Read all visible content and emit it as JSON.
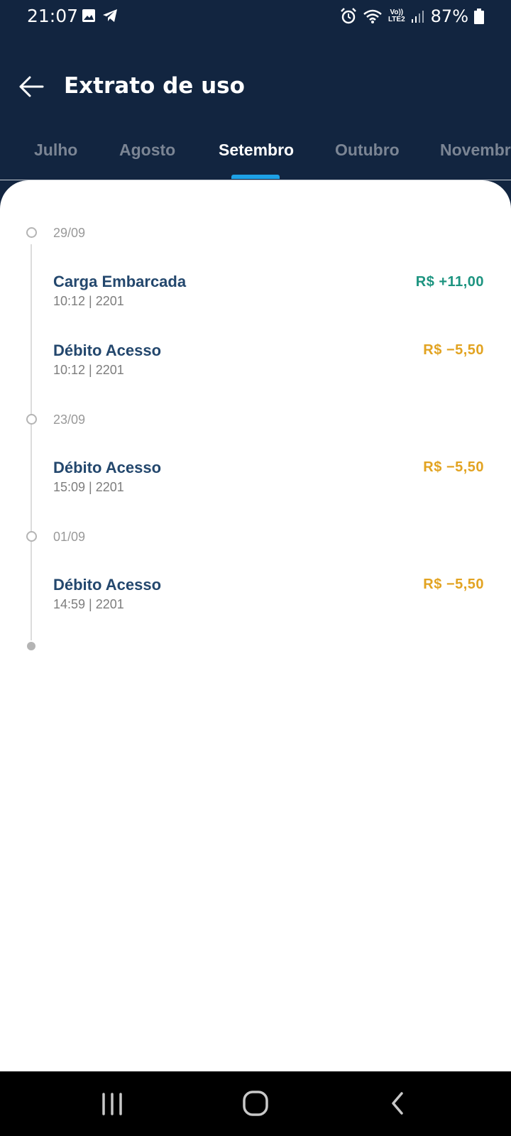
{
  "status_bar": {
    "time": "21:07",
    "lte_label_top": "Vo))",
    "lte_label_bottom": "LTE2",
    "battery": "87%"
  },
  "header": {
    "title": "Extrato de uso",
    "tabs": [
      {
        "label": "Julho"
      },
      {
        "label": "Agosto"
      },
      {
        "label": "Setembro",
        "active": true
      },
      {
        "label": "Outubro"
      },
      {
        "label": "Novembro"
      }
    ]
  },
  "timeline": [
    {
      "date": "29/09",
      "transactions": [
        {
          "title": "Carga Embarcada",
          "meta": "10:12 | 2201",
          "amount": "R$ +11,00",
          "kind": "credit"
        },
        {
          "title": "Débito Acesso",
          "meta": "10:12 | 2201",
          "amount": "R$ −5,50",
          "kind": "debit"
        }
      ]
    },
    {
      "date": "23/09",
      "transactions": [
        {
          "title": "Débito Acesso",
          "meta": "15:09 | 2201",
          "amount": "R$ −5,50",
          "kind": "debit"
        }
      ]
    },
    {
      "date": "01/09",
      "transactions": [
        {
          "title": "Débito Acesso",
          "meta": "14:59 | 2201",
          "amount": "R$ −5,50",
          "kind": "debit"
        }
      ]
    }
  ],
  "colors": {
    "header_bg": "#122540",
    "accent": "#1ea1e6",
    "credit": "#1d9480",
    "debit": "#e2a321",
    "title_text": "#23476d"
  },
  "icons": {
    "back": "arrow-left-icon",
    "recents": "recents-icon",
    "home": "home-icon",
    "nav_back": "chevron-left-icon"
  }
}
